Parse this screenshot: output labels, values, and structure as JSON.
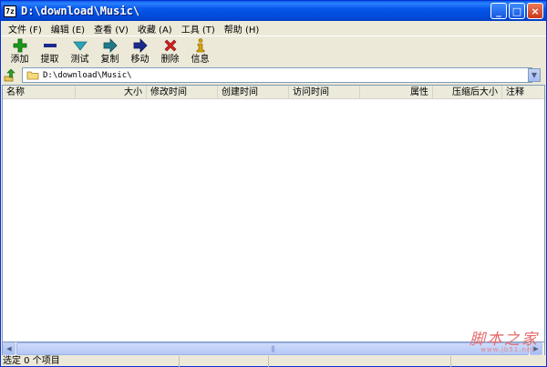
{
  "window": {
    "title": "D:\\download\\Music\\",
    "app_icon_text": "7z",
    "buttons": {
      "minimize": "_",
      "maximize": "□",
      "close": "×"
    }
  },
  "menu": [
    {
      "label": "文件 (F)"
    },
    {
      "label": "编辑 (E)"
    },
    {
      "label": "查看 (V)"
    },
    {
      "label": "收藏 (A)"
    },
    {
      "label": "工具 (T)"
    },
    {
      "label": "帮助 (H)"
    }
  ],
  "toolbar": [
    {
      "label": "添加",
      "icon": "add-icon",
      "color": "#1a9a1a"
    },
    {
      "label": "提取",
      "icon": "extract-icon",
      "color": "#1b2b8c"
    },
    {
      "label": "测试",
      "icon": "test-icon",
      "color": "#2aa6b6"
    },
    {
      "label": "复制",
      "icon": "copy-icon",
      "color": "#1f7a8a"
    },
    {
      "label": "移动",
      "icon": "move-icon",
      "color": "#1b2b8c"
    },
    {
      "label": "删除",
      "icon": "delete-icon",
      "color": "#d42020"
    },
    {
      "label": "信息",
      "icon": "info-icon",
      "color": "#d6a400"
    }
  ],
  "address": {
    "value": "D:\\download\\Music\\"
  },
  "columns": [
    {
      "label": "名称",
      "align": "left"
    },
    {
      "label": "大小",
      "align": "right"
    },
    {
      "label": "修改时间",
      "align": "left"
    },
    {
      "label": "创建时间",
      "align": "left"
    },
    {
      "label": "访问时间",
      "align": "left"
    },
    {
      "label": "属性",
      "align": "right"
    },
    {
      "label": "压缩后大小",
      "align": "right"
    },
    {
      "label": "注释",
      "align": "left"
    }
  ],
  "status": {
    "selected": "选定 0 个项目"
  },
  "watermark": {
    "main": "脚本之家",
    "sub": "www.jb51.net"
  }
}
